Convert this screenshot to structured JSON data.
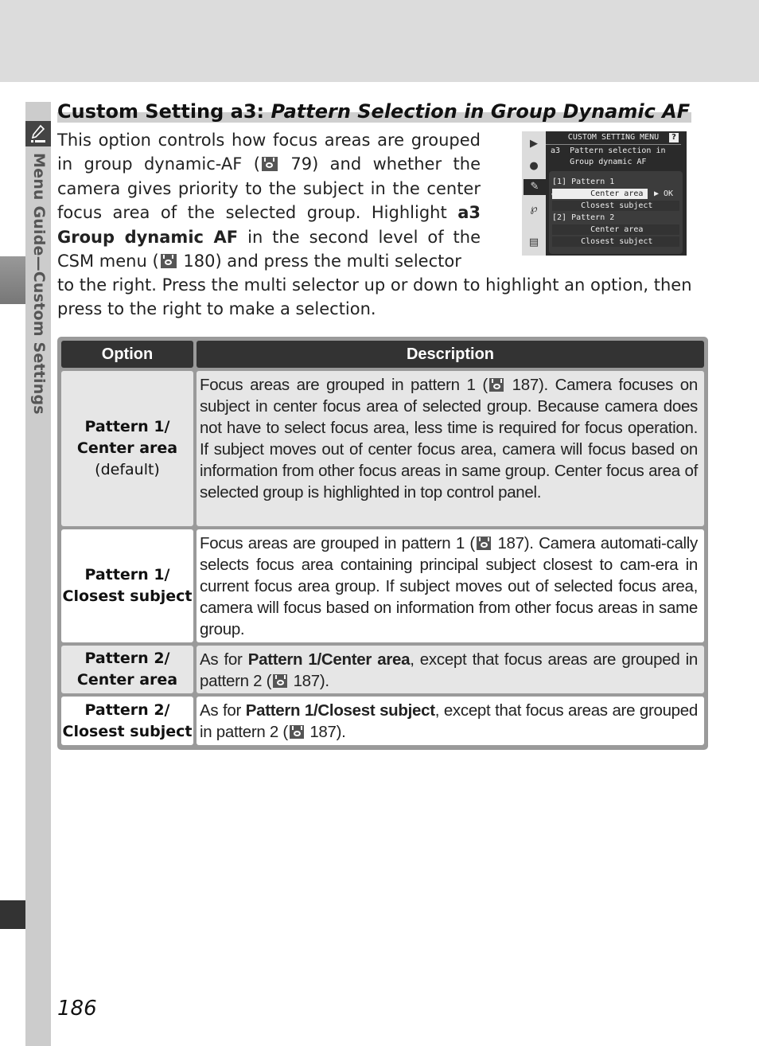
{
  "sidebar": {
    "section_label": "Menu Guide—Custom Settings",
    "icon": "pencil-icon"
  },
  "title": {
    "prefix": "Custom Setting a3: ",
    "italic": "Pattern Selection in Group Dynamic AF"
  },
  "intro": {
    "p1_a": "This option controls how focus areas are grouped in group dynamic-AF (",
    "p1_ref1": "79",
    "p1_b": ") and whether the camera gives priority to the subject in the center focus area of the selected group.  Highlight ",
    "p1_bold1": "a3 Group dynamic AF",
    "p1_c": " in the second level of the CSM menu (",
    "p1_ref2": "180",
    "p1_d": ") and press the multi selector",
    "p2": "to the right.  Press the multi selector up or down to highlight an option, then press to the right to make a selection.",
    "ref_icon": "eye-reference-icon"
  },
  "camera_screen": {
    "header": "CUSTOM SETTING MENU",
    "help": "?",
    "line1": "a3  Pattern selection in",
    "line2": "    Group dynamic AF",
    "tabs": [
      "playback-icon",
      "camera-icon",
      "pencil-icon",
      "wrench-icon",
      "recent-icon"
    ],
    "rows": [
      {
        "label": "[1] Pattern 1",
        "type": "group"
      },
      {
        "label": "        Center area",
        "type": "selected",
        "check": "✔",
        "ok": "▶ OK"
      },
      {
        "label": "      Closest subject",
        "type": "item"
      },
      {
        "label": "[2] Pattern 2",
        "type": "group"
      },
      {
        "label": "        Center area",
        "type": "item"
      },
      {
        "label": "      Closest subject",
        "type": "item"
      }
    ]
  },
  "table": {
    "headers": [
      "Option",
      "Description"
    ],
    "rows": [
      {
        "option_line1": "Pattern 1/",
        "option_line2": "Center area",
        "option_note": "(default)",
        "desc_a": "Focus areas are grouped in pattern 1 (",
        "desc_ref": "187",
        "desc_b": ").  Camera focuses on subject in center focus area of selected group.  Because camera does not have to select focus area, less time is required for focus operation.  If subject moves out of center focus area, camera will focus based on information from other focus areas in same group. Center focus area of selected group is highlighted in top control panel."
      },
      {
        "option_line1": "Pattern 1/",
        "option_line2": "Closest subject",
        "desc_a": "Focus areas are grouped in pattern 1 (",
        "desc_ref": "187",
        "desc_b": ").  Camera automati-cally selects focus area containing principal subject closest to cam-era in current focus area group.  If subject moves out of selected focus area, camera will focus based on information from other focus areas in same group."
      },
      {
        "option_line1": "Pattern 2/",
        "option_line2": "Center area",
        "desc_pre": "As for ",
        "desc_bold": "Pattern 1/Center area",
        "desc_a": ", except that focus areas are grouped in pattern 2 (",
        "desc_ref": "187",
        "desc_b": ")."
      },
      {
        "option_line1": "Pattern 2/",
        "option_line2": "Closest subject",
        "desc_pre": "As for ",
        "desc_bold": "Pattern 1/Closest subject",
        "desc_a": ", except that focus areas are grouped in pattern 2 (",
        "desc_ref": "187",
        "desc_b": ")."
      }
    ]
  },
  "page_number": "186"
}
